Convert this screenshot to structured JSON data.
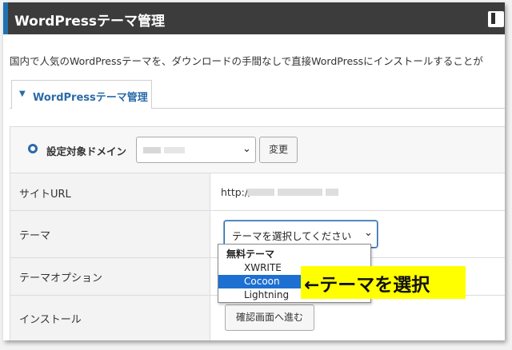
{
  "header": {
    "title": "WordPressテーマ管理",
    "accent_color": "#2271b1",
    "bar_color": "#3c3c3c",
    "help_icon": "book-icon"
  },
  "intro": "国内で人気のWordPressテーマを、ダウンロードの手間なしで直接WordPressにインストールすることが",
  "tab": {
    "label": "WordPressテーマ管理",
    "icon": "chevron-down-icon",
    "color": "#2a6aa8"
  },
  "domain": {
    "label": "設定対象ドメイン",
    "change_label": "変更"
  },
  "rows": {
    "site_url_label": "サイトURL",
    "site_url_value": "http://",
    "theme_label": "テーマ",
    "theme_select_value": "テーマを選択してください",
    "theme_option_label": "テーマオプション",
    "install_label": "インストール",
    "install_button": "確認画面へ進む"
  },
  "dropdown": {
    "group": "無料テーマ",
    "options": [
      "XWRITE",
      "Cocoon",
      "Lightning"
    ],
    "selected": "Cocoon",
    "highlight_color": "#1e6fd2"
  },
  "callout": {
    "text": "←テーマを選択",
    "color": "#ffff00"
  }
}
